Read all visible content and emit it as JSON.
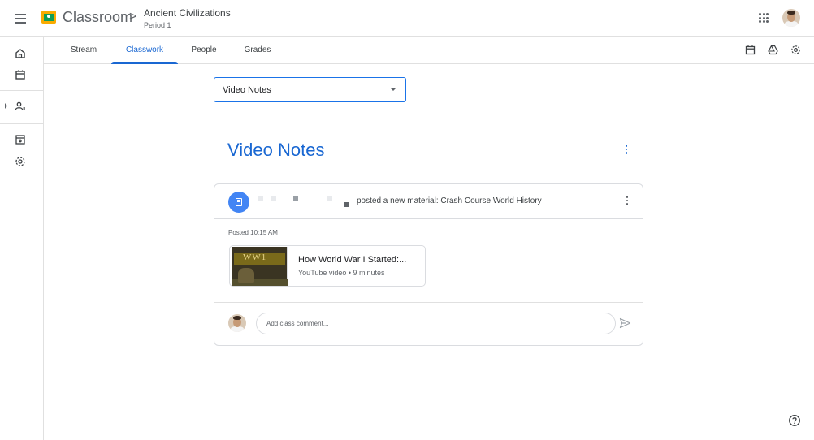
{
  "app": {
    "name": "Classroom",
    "breadcrumb_separator": ">",
    "class_name": "Ancient Civilizations",
    "class_section": "Period 1"
  },
  "header": {
    "menu_icon": "hamburger-icon",
    "apps_icon": "apps-grid-icon",
    "avatar": "user-avatar"
  },
  "tabs": [
    {
      "label": "Stream",
      "active": false
    },
    {
      "label": "Classwork",
      "active": true
    },
    {
      "label": "People",
      "active": false
    },
    {
      "label": "Grades",
      "active": false
    }
  ],
  "tab_icons": [
    "calendar-icon",
    "drive-icon",
    "settings-icon"
  ],
  "sidebar": {
    "items": [
      "home-icon",
      "calendar-icon",
      "enrolled-classes-icon",
      "archived-classes-icon",
      "settings-icon"
    ]
  },
  "topic_filter": {
    "selected": "Video Notes"
  },
  "topic": {
    "title": "Video Notes"
  },
  "post": {
    "icon": "material-book-icon",
    "action_text": "posted a new material: Crash Course World History",
    "posted_time": "Posted 10:15 AM",
    "attachment": {
      "title": "How World War I Started:...",
      "meta": "YouTube video • 9 minutes",
      "thumbnail_text": "WW1"
    },
    "comment_placeholder": "Add class comment..."
  },
  "colors": {
    "accent": "#1967d2",
    "material_icon_bg": "#4285f4",
    "divider": "#dadce0"
  }
}
